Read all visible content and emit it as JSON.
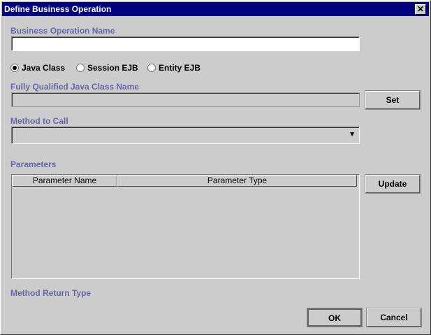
{
  "window": {
    "title": "Define Business Operation",
    "close_icon": "close-icon"
  },
  "form": {
    "op_name_label": "Business Operation Name",
    "op_name_value": "",
    "radios": [
      {
        "label": "Java Class",
        "selected": true
      },
      {
        "label": "Session EJB",
        "selected": false
      },
      {
        "label": "Entity EJB",
        "selected": false
      }
    ],
    "class_name_label": "Fully Qualified Java Class Name",
    "class_name_value": "",
    "set_button": "Set",
    "method_label": "Method to Call",
    "method_value": "",
    "params_label": "Parameters",
    "params_columns": [
      "Parameter Name",
      "Parameter Type"
    ],
    "update_button": "Update",
    "return_type_label": "Method Return Type"
  },
  "footer": {
    "ok": "OK",
    "cancel": "Cancel"
  }
}
